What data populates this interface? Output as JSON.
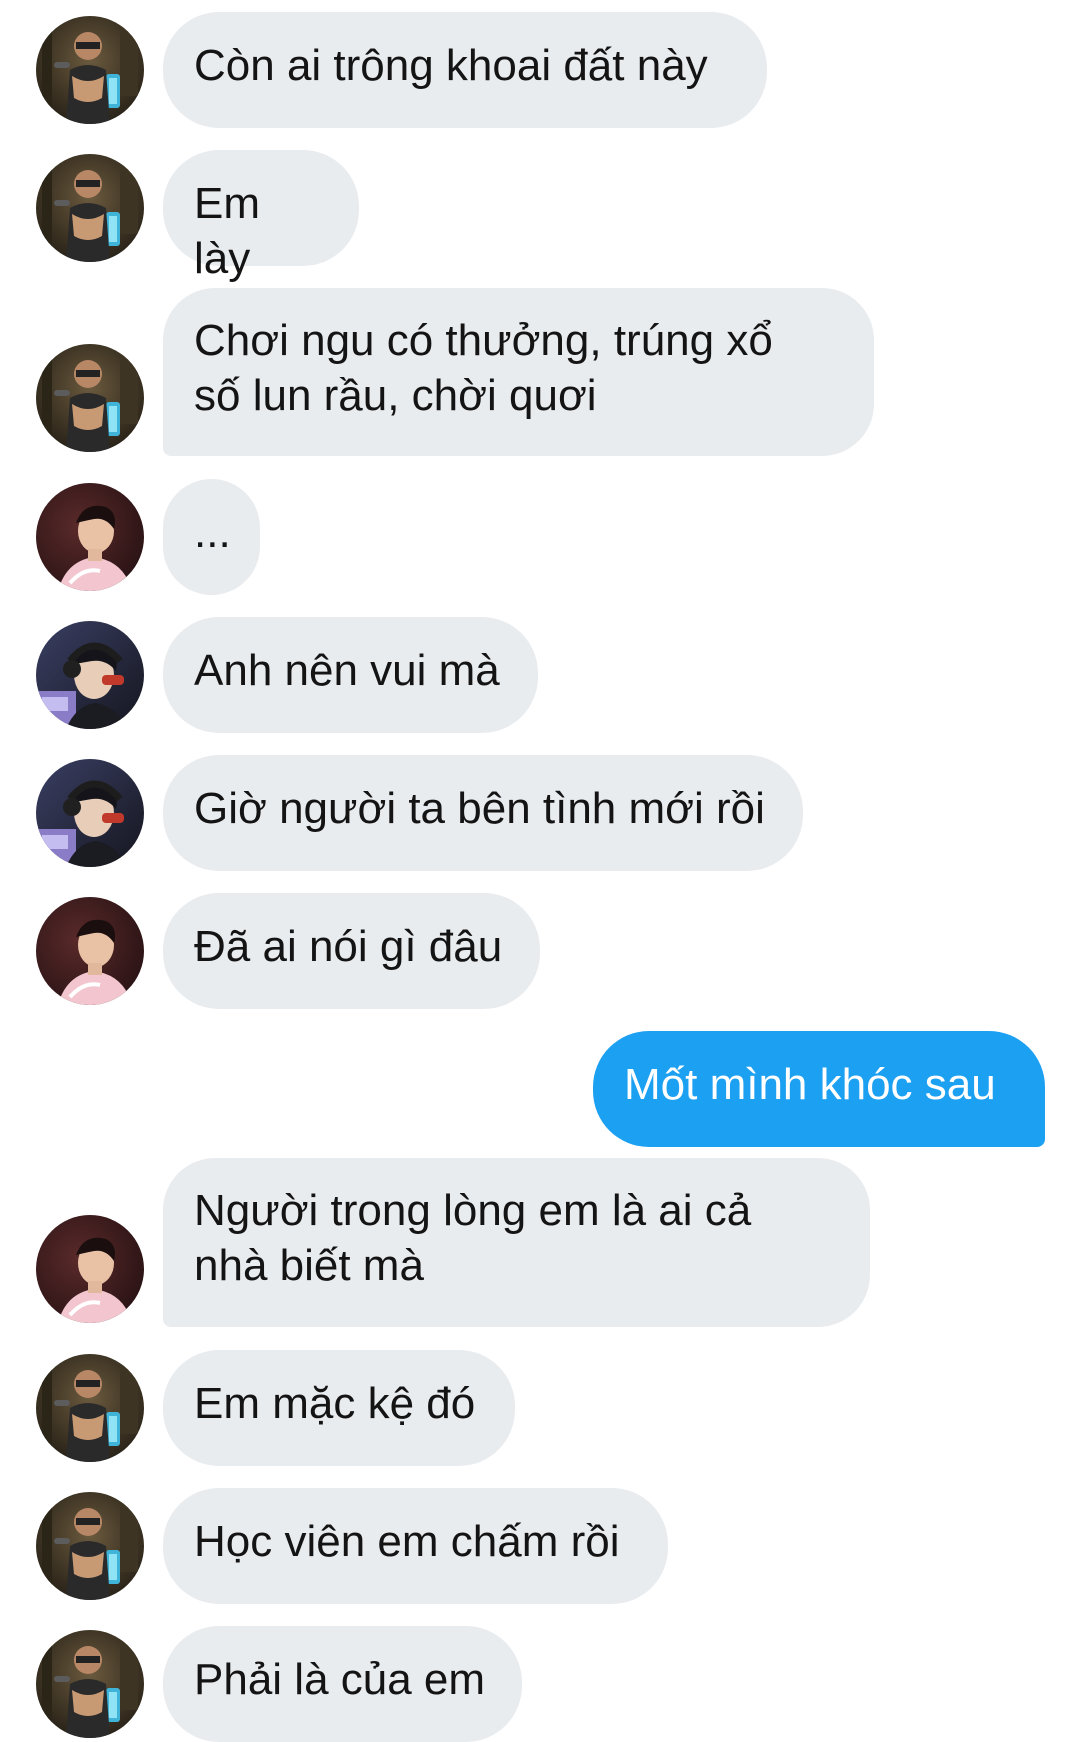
{
  "conversation": {
    "messages": [
      {
        "sender": "friend-a",
        "text": "Còn ai trông khoai đất này"
      },
      {
        "sender": "friend-a",
        "text": "Em lày"
      },
      {
        "sender": "friend-a",
        "text": "Chơi ngu có thưởng, trúng xổ\nsố lun rầu, chời quơi"
      },
      {
        "sender": "friend-b",
        "text": "..."
      },
      {
        "sender": "friend-c",
        "text": "Anh nên vui mà"
      },
      {
        "sender": "friend-c",
        "text": "Giờ người ta bên tình mới rồi"
      },
      {
        "sender": "friend-b",
        "text": "Đã ai nói gì đâu"
      },
      {
        "sender": "me",
        "text": "Mốt mình khóc sau"
      },
      {
        "sender": "friend-b",
        "text": "Người trong lòng em là ai cả\nnhà biết mà"
      },
      {
        "sender": "friend-a",
        "text": "Em mặc kệ đó"
      },
      {
        "sender": "friend-a",
        "text": "Học viên em chấm rồi"
      },
      {
        "sender": "friend-a",
        "text": "Phải là của em"
      }
    ]
  },
  "colors": {
    "incoming_bubble": "#e9ecef",
    "outgoing_bubble": "#1ca0f2",
    "incoming_text": "#141414",
    "outgoing_text": "#ffffff"
  }
}
